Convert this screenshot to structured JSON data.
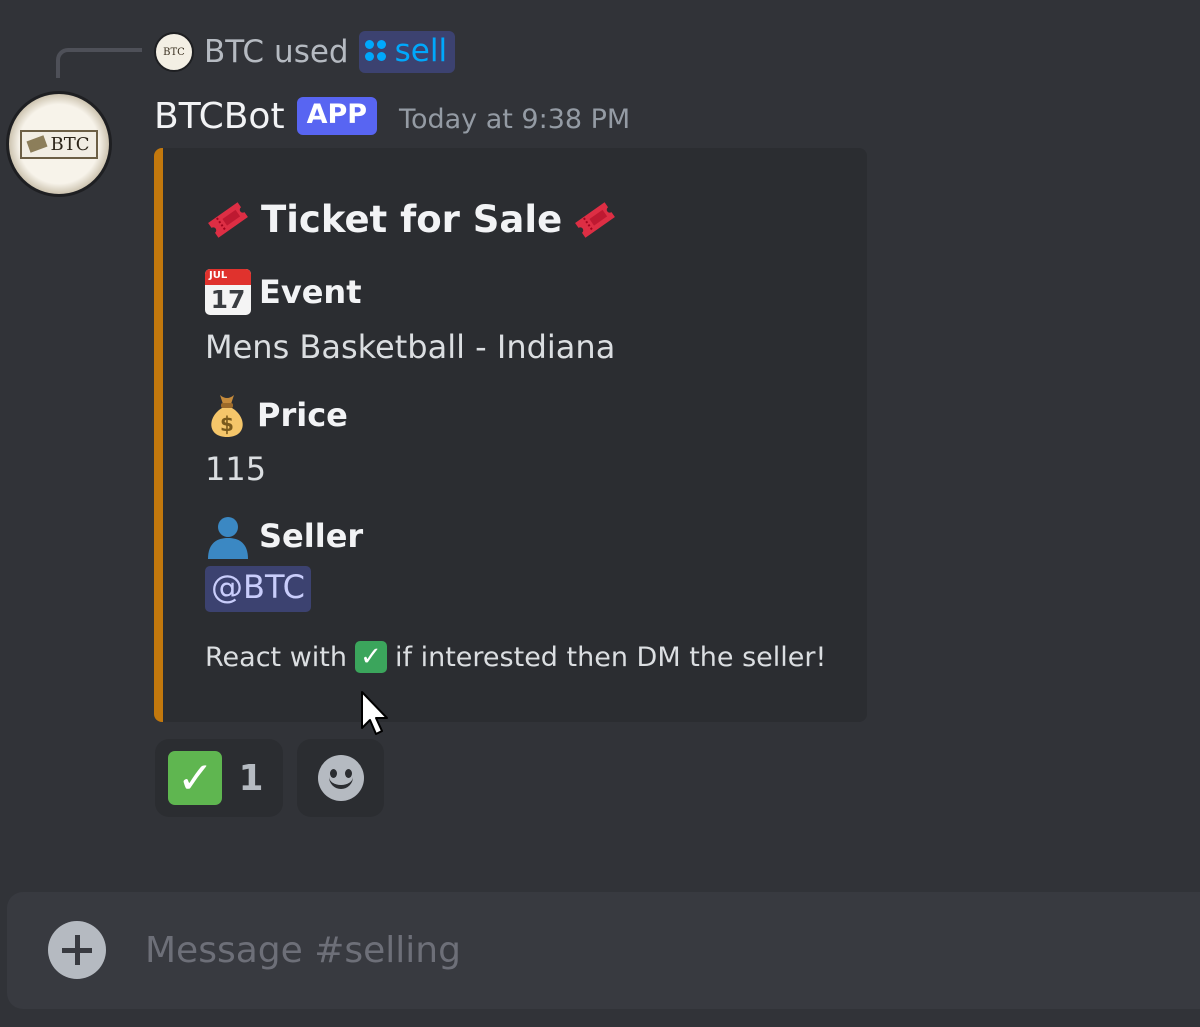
{
  "command_line": {
    "user": "BTC",
    "used_text": "used",
    "command": "sell"
  },
  "message": {
    "author": "BTCBot",
    "badge": "APP",
    "timestamp": "Today at 9:38 PM",
    "avatar_text": "BTC"
  },
  "embed": {
    "accent_color": "#c2780d",
    "title": "Ticket for Sale",
    "fields": [
      {
        "icon": "calendar-icon",
        "name": "Event",
        "value": "Mens Basketball - Indiana"
      },
      {
        "icon": "money-bag-icon",
        "name": "Price",
        "value": "115"
      },
      {
        "icon": "person-icon",
        "name": "Seller",
        "value": "@BTC"
      }
    ],
    "footer_before": "React with",
    "footer_after": "if interested then DM the seller!",
    "calendar_month": "JUL",
    "calendar_day": "17"
  },
  "reactions": [
    {
      "emoji": "check-mark-icon",
      "count": "1"
    },
    {
      "emoji": "add-reaction-icon"
    }
  ],
  "composer": {
    "placeholder": "Message #selling"
  },
  "colors": {
    "background": "#313338",
    "embed_background": "#2b2d31",
    "badge": "#5865f2",
    "mention": "#3c4270",
    "command_link": "#00a8fc"
  }
}
